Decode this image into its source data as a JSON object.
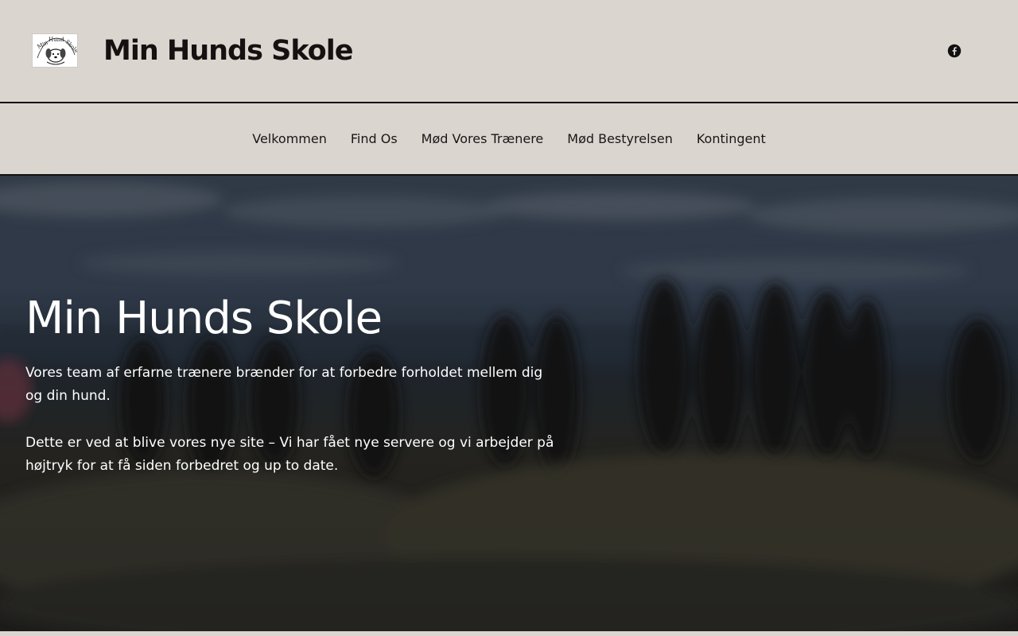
{
  "site": {
    "title": "Min Hunds Skole",
    "logo_text": "Min Hund Skole"
  },
  "header": {
    "social": [
      {
        "icon": "facebook-icon",
        "label": "Facebook"
      }
    ]
  },
  "nav": {
    "items": [
      {
        "label": "Velkommen"
      },
      {
        "label": "Find Os"
      },
      {
        "label": "Mød Vores Trænere"
      },
      {
        "label": "Mød Bestyrelsen"
      },
      {
        "label": "Kontingent"
      }
    ]
  },
  "hero": {
    "title": "Min Hunds Skole",
    "paragraph1": "Vores team af erfarne trænere brænder for at forbedre forholdet mellem dig og din hund.",
    "paragraph2": "Dette er ved at blive vores nye site – Vi har fået nye servere og vi arbejder på højtryk for at få siden forbedret og up to date."
  },
  "colors": {
    "background": "#dbd5d0",
    "text": "#161110",
    "hero_text": "#ffffff"
  }
}
